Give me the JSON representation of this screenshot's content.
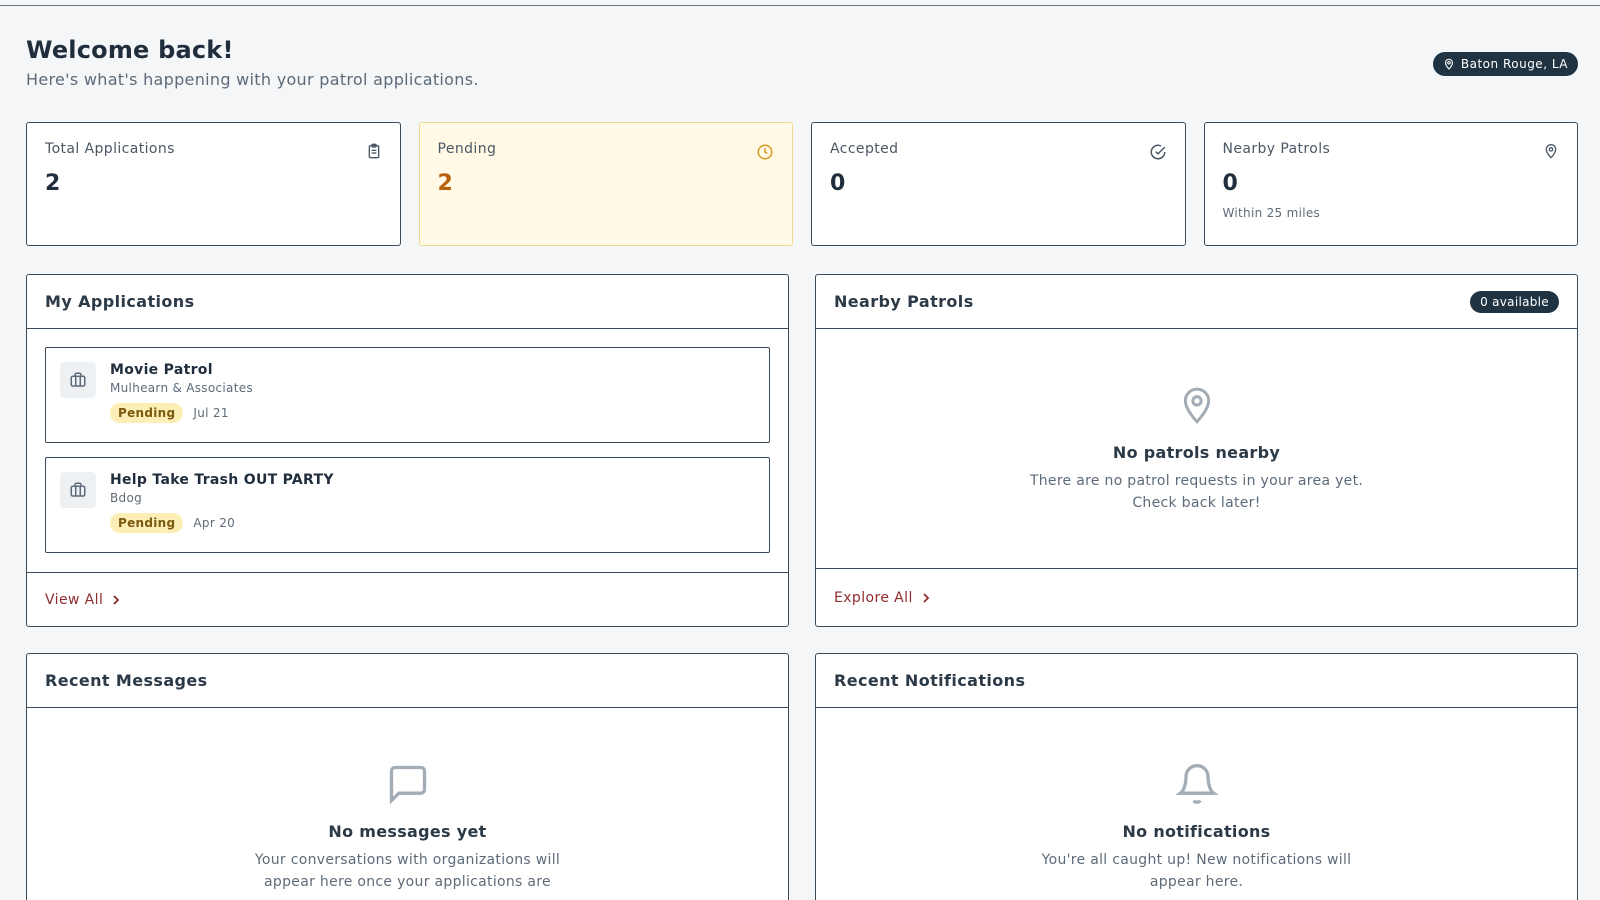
{
  "header": {
    "title": "Welcome back!",
    "subtitle": "Here's what's happening with your patrol applications.",
    "location": "Baton Rouge, LA"
  },
  "stats": [
    {
      "label": "Total Applications",
      "value": "2",
      "icon": "clipboard-icon"
    },
    {
      "label": "Pending",
      "value": "2",
      "icon": "clock-icon"
    },
    {
      "label": "Accepted",
      "value": "0",
      "icon": "check-circle-icon"
    },
    {
      "label": "Nearby Patrols",
      "value": "0",
      "sub": "Within 25 miles",
      "icon": "map-pin-icon"
    }
  ],
  "my_applications": {
    "title": "My Applications",
    "items": [
      {
        "title": "Movie Patrol",
        "org": "Mulhearn & Associates",
        "status": "Pending",
        "date": "Jul 21"
      },
      {
        "title": "Help Take Trash OUT PARTY",
        "org": "Bdog",
        "status": "Pending",
        "date": "Apr 20"
      }
    ],
    "footer_link": "View All"
  },
  "nearby_patrols": {
    "title": "Nearby Patrols",
    "badge": "0 available",
    "empty_title": "No patrols nearby",
    "empty_line1": "There are no patrol requests in your area yet.",
    "empty_line2": "Check back later!",
    "footer_link": "Explore All"
  },
  "recent_messages": {
    "title": "Recent Messages",
    "empty_title": "No messages yet",
    "empty_line1": "Your conversations with organizations will",
    "empty_line2": "appear here once your applications are"
  },
  "recent_notifications": {
    "title": "Recent Notifications",
    "empty_title": "No notifications",
    "empty_line1": "You're all caught up! New notifications will",
    "empty_line2": "appear here."
  },
  "colors": {
    "accent_dark": "#1f3342",
    "link_red": "#8f2d2d",
    "pending_bg": "#fff9e6",
    "pending_value": "#b8610a"
  }
}
